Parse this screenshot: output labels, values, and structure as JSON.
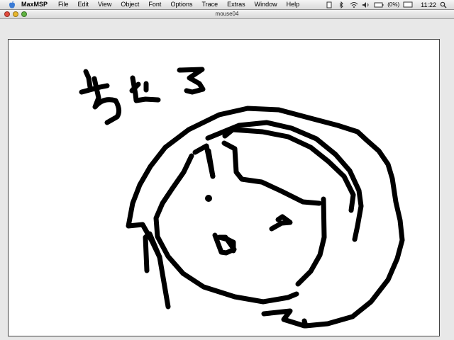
{
  "menubar": {
    "app_name": "MaxMSP",
    "items": [
      "File",
      "Edit",
      "View",
      "Object",
      "Font",
      "Options",
      "Trace",
      "Extras",
      "Window",
      "Help"
    ],
    "battery_text": "(0%)",
    "clock": "11:22"
  },
  "window": {
    "title": "mouse04"
  }
}
